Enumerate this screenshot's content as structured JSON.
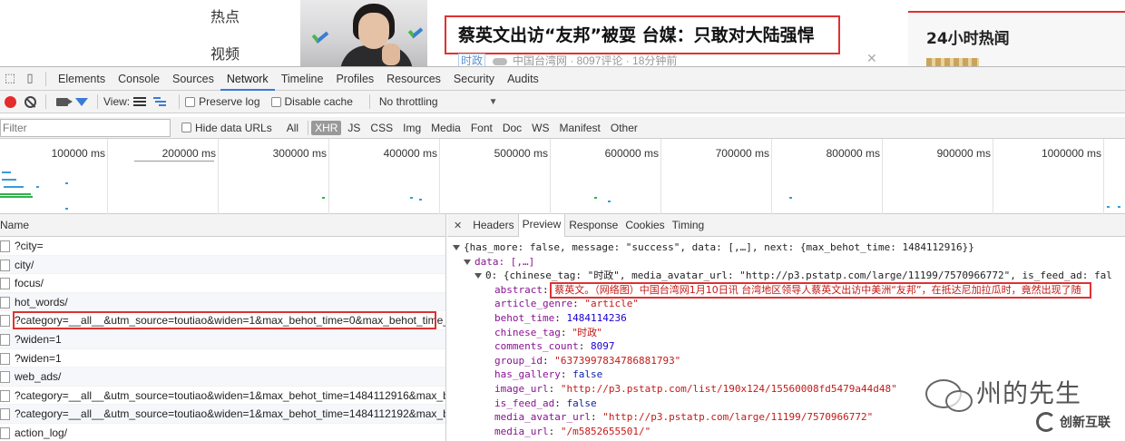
{
  "webpage": {
    "nav": [
      "热点",
      "视频"
    ],
    "headline": "蔡英文出访“友邦”被耍 台媒：只敢对大陆强悍",
    "meta_tag": "时政",
    "meta_text": "中国台湾网 · 8097评论 · 18分钟前",
    "hot_title": "24小时热闻"
  },
  "devtools": {
    "tabs": [
      "Elements",
      "Console",
      "Sources",
      "Network",
      "Timeline",
      "Profiles",
      "Resources",
      "Security",
      "Audits"
    ],
    "active_tab": "Network",
    "toolbar2": {
      "view_label": "View:",
      "preserve_log": "Preserve log",
      "disable_cache": "Disable cache",
      "throttling": "No throttling"
    },
    "filter": {
      "placeholder": "Filter",
      "hide_data_urls": "Hide data URLs",
      "types": [
        "All",
        "XHR",
        "JS",
        "CSS",
        "Img",
        "Media",
        "Font",
        "Doc",
        "WS",
        "Manifest",
        "Other"
      ],
      "active_type": "XHR"
    },
    "timeline_ticks": [
      "100000 ms",
      "200000 ms",
      "300000 ms",
      "400000 ms",
      "500000 ms",
      "600000 ms",
      "700000 ms",
      "800000 ms",
      "900000 ms",
      "1000000 ms"
    ],
    "list_header": "Name",
    "requests": [
      "?city=",
      "city/",
      "focus/",
      "hot_words/",
      "?category=__all__&utm_source=toutiao&widen=1&max_behot_time=0&max_behot_time_...",
      "?widen=1",
      "?widen=1",
      "web_ads/",
      "?category=__all__&utm_source=toutiao&widen=1&max_behot_time=1484112916&max_b...",
      "?category=__all__&utm_source=toutiao&widen=1&max_behot_time=1484112192&max_b...",
      "action_log/"
    ],
    "detail_tabs": [
      "Headers",
      "Preview",
      "Response",
      "Cookies",
      "Timing"
    ],
    "active_detail_tab": "Preview",
    "preview": {
      "root_line": "{has_more: false, message: \"success\", data: [,…], next: {max_behot_time: 1484112916}}",
      "data_line": "data: [,…]",
      "item0_line": "0: {chinese_tag: \"时政\", media_avatar_url: \"http://p3.pstatp.com/large/11199/7570966772\", is_feed_ad: fal",
      "fields": [
        {
          "key": "abstract",
          "value": "蔡英文。（网络图）中国台湾网1月10日讯 台湾地区领导人蔡英文出访中美洲“友邦”，在抵达尼加拉瓜时，竟然出现了随",
          "kind": "cn"
        },
        {
          "key": "article_genre",
          "value": "\"article\"",
          "kind": "s"
        },
        {
          "key": "behot_time",
          "value": "1484114236",
          "kind": "n"
        },
        {
          "key": "chinese_tag",
          "value": "\"时政\"",
          "kind": "cn"
        },
        {
          "key": "comments_count",
          "value": "8097",
          "kind": "n"
        },
        {
          "key": "group_id",
          "value": "\"6373997834786881793\"",
          "kind": "s"
        },
        {
          "key": "has_gallery",
          "value": "false",
          "kind": "b"
        },
        {
          "key": "image_url",
          "value": "\"http://p3.pstatp.com/list/190x124/15560008fd5479a44d48\"",
          "kind": "s"
        },
        {
          "key": "is_feed_ad",
          "value": "false",
          "kind": "b"
        },
        {
          "key": "media_avatar_url",
          "value": "\"http://p3.pstatp.com/large/11199/7570966772\"",
          "kind": "s"
        },
        {
          "key": "media_url",
          "value": "\"/m5852655501/\"",
          "kind": "s"
        }
      ]
    }
  },
  "watermark": {
    "name": "州的先生",
    "brand": "创新互联"
  },
  "colors": {
    "highlight": "#e03131",
    "accent": "#3879d9"
  }
}
